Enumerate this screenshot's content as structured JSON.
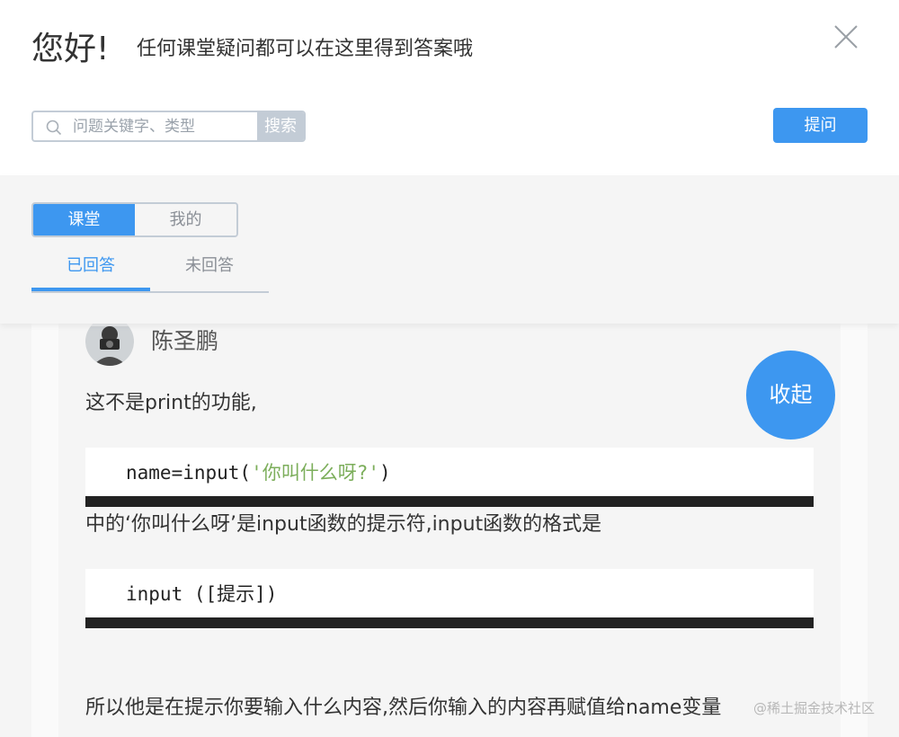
{
  "header": {
    "greeting": "您好!",
    "subtitle": "任何课堂疑问都可以在这里得到答案哦",
    "search_placeholder": "问题关键字、类型",
    "search_button": "搜索",
    "ask_button": "提问"
  },
  "filter": {
    "segments": [
      "课堂",
      "我的"
    ],
    "tabs": [
      "已回答",
      "未回答"
    ]
  },
  "answer": {
    "author": "陈圣鹏",
    "collapse_button": "收起",
    "line1": "这不是print的功能,",
    "code1_prefix": "name=input(",
    "code1_string": "'你叫什么呀?'",
    "code1_suffix": ")",
    "line2": "中的‘你叫什么呀’是input函数的提示符,input函数的格式是",
    "code2": "input ([提示])",
    "line3": "所以他是在提示你要输入什么内容,然后你输入的内容再赋值给name变量"
  },
  "watermark": "@稀土掘金技术社区",
  "colors": {
    "accent": "#3d97f0",
    "border": "#c3ccd6",
    "code_string": "#7cae5b"
  }
}
